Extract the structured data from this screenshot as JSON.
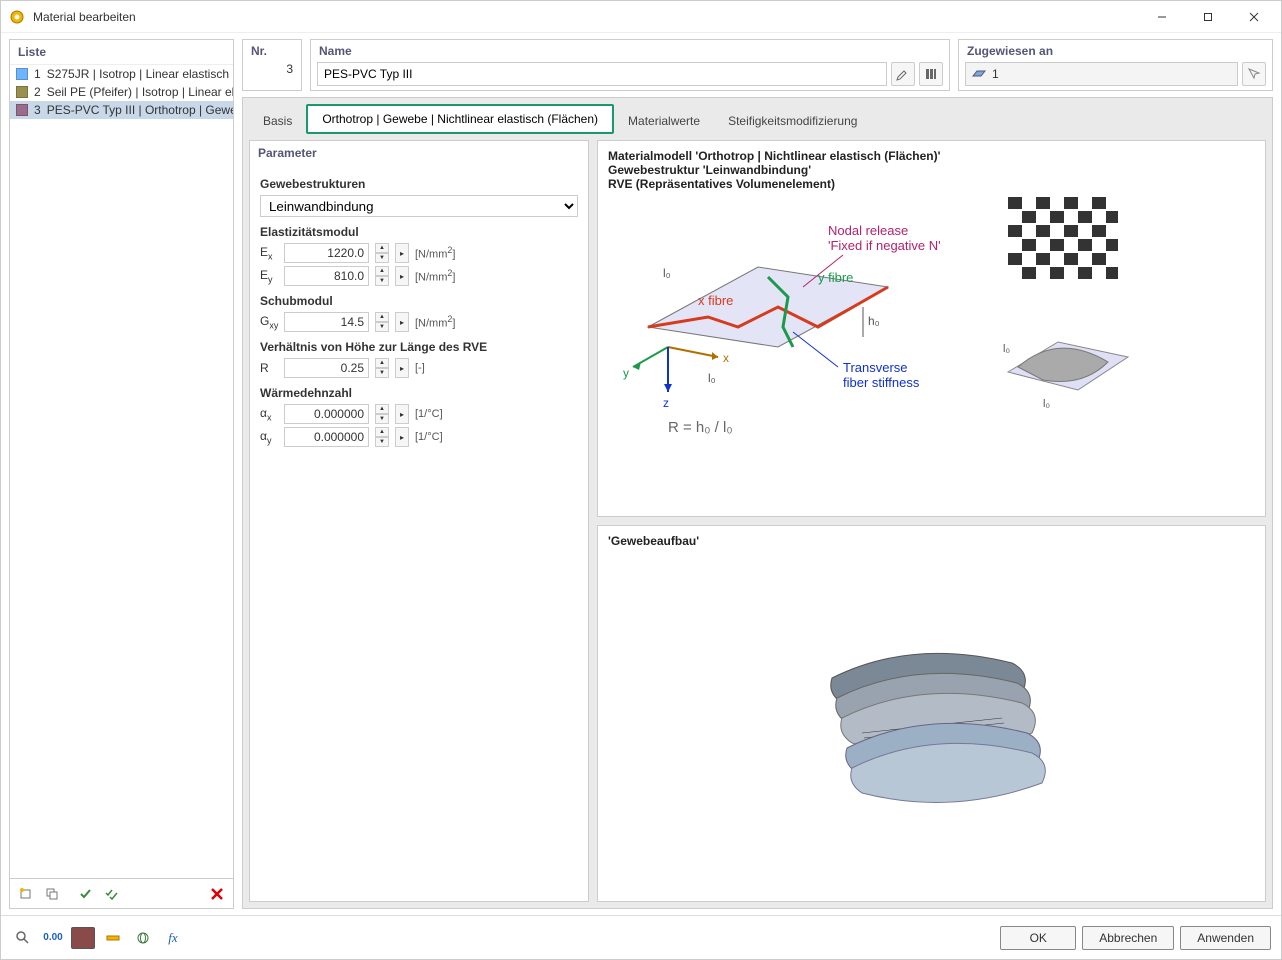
{
  "window": {
    "title": "Material bearbeiten"
  },
  "sidebar": {
    "header": "Liste",
    "items": [
      {
        "num": "1",
        "text": "S275JR | Isotrop | Linear elastisch",
        "color": "#6EB5FF",
        "selected": false
      },
      {
        "num": "2",
        "text": "Seil PE (Pfeifer) | Isotrop | Linear elastisch",
        "color": "#999050",
        "selected": false
      },
      {
        "num": "3",
        "text": "PES-PVC Typ III | Orthotrop | Gewebe",
        "color": "#9A6C8C",
        "selected": true
      }
    ]
  },
  "top": {
    "nr_label": "Nr.",
    "nr_value": "3",
    "name_label": "Name",
    "name_value": "PES-PVC Typ III",
    "assigned_label": "Zugewiesen an",
    "assigned_value": "1"
  },
  "tabs": {
    "basis": "Basis",
    "orthotrop": "Orthotrop | Gewebe | Nichtlinear elastisch (Flächen)",
    "material": "Materialwerte",
    "steif": "Steifigkeitsmodifizierung"
  },
  "params": {
    "header": "Parameter",
    "gewebe_label": "Gewebestrukturen",
    "gewebe_value": "Leinwandbindung",
    "emod_label": "Elastizitätsmodul",
    "ex_label": "Eₓ",
    "ex_value": "1220.0",
    "ex_unit": "[N/mm²]",
    "ey_label": "Eᵧ",
    "ey_value": "810.0",
    "ey_unit": "[N/mm²]",
    "schub_label": "Schubmodul",
    "gxy_label": "Gxy",
    "gxy_value": "14.5",
    "gxy_unit": "[N/mm²]",
    "ratio_label": "Verhältnis von Höhe zur Länge des RVE",
    "r_label": "R",
    "r_value": "0.25",
    "r_unit": "[-]",
    "warm_label": "Wärmedehnzahl",
    "ax_label": "αₓ",
    "ax_value": "0.000000",
    "ax_unit": "[1/°C]",
    "ay_label": "αᵧ",
    "ay_value": "0.000000",
    "ay_unit": "[1/°C]"
  },
  "diagram": {
    "line1": "Materialmodell 'Orthotrop | Nichtlinear elastisch (Flächen)'",
    "line2": "Gewebestruktur 'Leinwandbindung'",
    "line3": "RVE (Repräsentatives Volumenelement)",
    "nodal1": "Nodal release",
    "nodal2": "'Fixed if negative N'",
    "xfibre": "x fibre",
    "yfibre": "y fibre",
    "trans1": "Transverse",
    "trans2": "fiber stiffness",
    "formula": "R = h₀ / l₀",
    "panel2_title": "'Gewebeaufbau'"
  },
  "footer": {
    "ok": "OK",
    "cancel": "Abbrechen",
    "apply": "Anwenden"
  }
}
